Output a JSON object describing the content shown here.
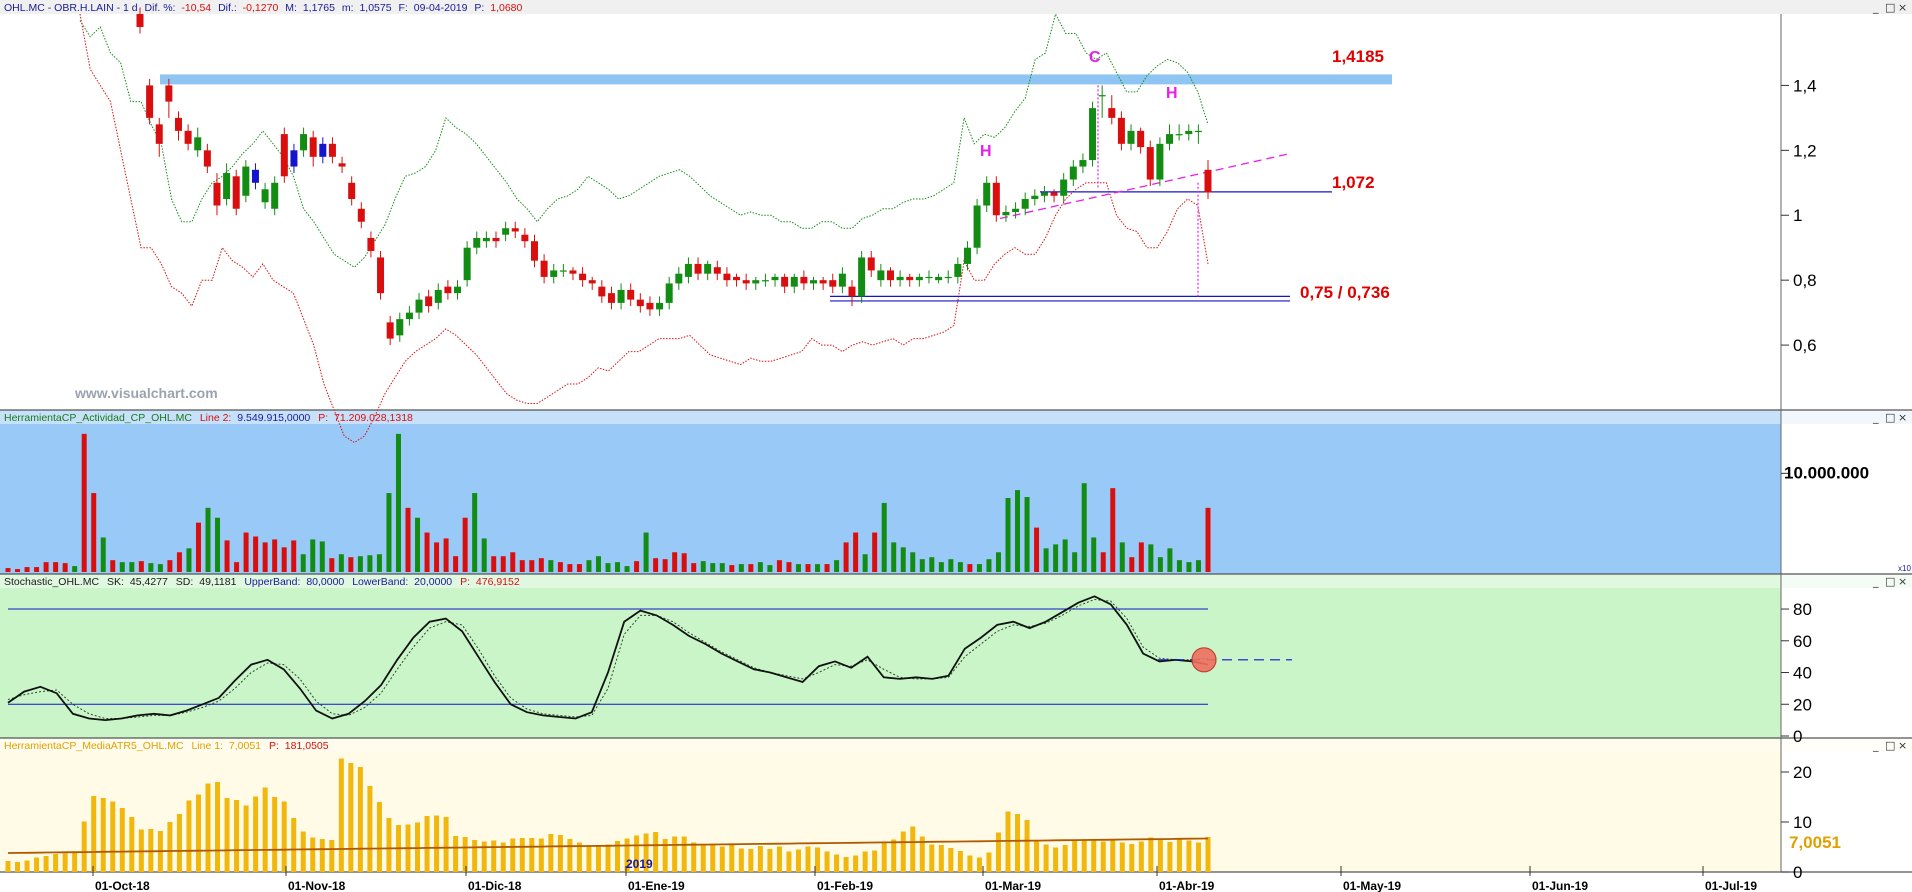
{
  "header": {
    "symbol": "OHL.MC - OBR.H.LAIN - 1 d",
    "dif_pct_label": "Dif. %:",
    "dif_pct_value": "-10,54",
    "dif_label": "Dif.:",
    "dif_value": "-0,1270",
    "max_label": "M:",
    "max_value": "1,1765",
    "min_label": "m:",
    "min_value": "1,0575",
    "date_label": "F:",
    "date_value": "09-04-2019",
    "price_label": "P:",
    "price_value": "1,0680"
  },
  "watermark": "www.visualchart.com",
  "window_buttons": [
    "_",
    "□",
    "×"
  ],
  "colors": {
    "up": "#138c13",
    "down": "#d90f0f",
    "inside": "#1515cc",
    "resistance_band": "#8ec5f2",
    "volume_bg": "#99c9f7",
    "stoch_bg": "#c9f5c9",
    "atr_bg": "#fffbe6",
    "atr_bar": "#f2b70d",
    "annotation_red": "#e00000",
    "annotation_magenta": "#e81ee8"
  },
  "panels": {
    "volume": {
      "title": "HerramientaCP_Actividad_CP_OHL.MC",
      "line_label": "Line 2:",
      "line_value": "9.549.915,0000",
      "p_label": "P:",
      "p_value": "71.209.028,1318",
      "scale_note": "x10"
    },
    "stochastic": {
      "title": "Stochastic_OHL.MC",
      "sk_label": "SK:",
      "sk_value": "45,4277",
      "sd_label": "SD:",
      "sd_value": "49,1181",
      "upper_label": "UpperBand:",
      "upper_value": "80,0000",
      "lower_label": "LowerBand:",
      "lower_value": "20,0000",
      "p_label": "P:",
      "p_value": "476,9152"
    },
    "atr": {
      "title": "HerramientaCP_MediaATR5_OHL.MC",
      "line_label": "Line 1:",
      "line_value": "7,0051",
      "p_label": "P:",
      "p_value": "181,0505",
      "last_value_label": "7,0051"
    }
  },
  "annotations": {
    "resistance": "1,4185",
    "neckline": "1,072",
    "target": "0,75 / 0,736",
    "pattern_h_left": "H",
    "pattern_c": "C",
    "pattern_h_right": "H",
    "year_marker": "2019"
  },
  "chart_data": [
    {
      "type": "candlestick",
      "name": "OHL.MC price",
      "yticks": [
        "1,4",
        "1,2",
        "1",
        "0,8",
        "0,6"
      ],
      "ylim": [
        0.4,
        1.62
      ],
      "x_ticks": [
        "01-Oct-18",
        "01-Nov-18",
        "01-Dic-18",
        "01-Ene-19",
        "01-Feb-19",
        "01-Mar-19",
        "01-Abr-19",
        "01-May-19",
        "01-Jun-19",
        "01-Jul-19"
      ],
      "close": [
        1.58,
        1.3,
        1.22,
        1.35,
        1.26,
        1.22,
        1.24,
        1.15,
        1.03,
        1.13,
        1.02,
        1.15,
        1.1,
        1.08,
        1.1,
        1.12,
        1.15,
        1.25,
        1.18,
        1.22,
        1.18,
        1.15,
        1.05,
        0.98,
        0.89,
        0.76,
        0.62,
        0.68,
        0.7,
        0.74,
        0.72,
        0.77,
        0.76,
        0.78,
        0.9,
        0.93,
        0.93,
        0.92,
        0.96,
        0.95,
        0.92,
        0.86,
        0.81,
        0.83,
        0.83,
        0.82,
        0.8,
        0.79,
        0.75,
        0.73,
        0.77,
        0.74,
        0.72,
        0.71,
        0.73,
        0.79,
        0.82,
        0.85,
        0.82,
        0.85,
        0.82,
        0.8,
        0.8,
        0.79,
        0.8,
        0.8,
        0.81,
        0.78,
        0.81,
        0.79,
        0.8,
        0.79,
        0.78,
        0.82,
        0.75,
        0.87,
        0.83,
        0.83,
        0.8,
        0.81,
        0.8,
        0.81,
        0.81,
        0.81,
        0.81,
        0.85,
        0.9,
        1.03,
        1.1,
        1.0,
        1.01,
        1.02,
        1.05,
        1.06,
        1.07,
        1.06,
        1.11,
        1.15,
        1.17,
        1.33,
        1.37,
        1.3,
        1.22,
        1.26,
        1.21,
        1.11,
        1.22,
        1.25,
        1.25,
        1.26,
        1.26,
        1.07
      ],
      "open": [
        1.62,
        1.4,
        1.28,
        1.4,
        1.3,
        1.26,
        1.2,
        1.2,
        1.1,
        1.05,
        1.12,
        1.06,
        1.14,
        1.04,
        1.02,
        1.25,
        1.2,
        1.2,
        1.24,
        1.18,
        1.22,
        1.16,
        1.1,
        1.02,
        0.93,
        0.87,
        0.67,
        0.63,
        0.68,
        0.7,
        0.75,
        0.73,
        0.78,
        0.76,
        0.8,
        0.9,
        0.92,
        0.93,
        0.94,
        0.96,
        0.94,
        0.92,
        0.86,
        0.81,
        0.83,
        0.83,
        0.82,
        0.8,
        0.78,
        0.76,
        0.73,
        0.77,
        0.74,
        0.73,
        0.71,
        0.73,
        0.79,
        0.81,
        0.85,
        0.82,
        0.84,
        0.82,
        0.81,
        0.8,
        0.79,
        0.8,
        0.8,
        0.81,
        0.78,
        0.81,
        0.79,
        0.8,
        0.8,
        0.78,
        0.78,
        0.75,
        0.87,
        0.8,
        0.83,
        0.8,
        0.81,
        0.8,
        0.81,
        0.8,
        0.81,
        0.81,
        0.85,
        0.9,
        1.03,
        1.1,
        1.0,
        1.01,
        1.02,
        1.05,
        1.06,
        1.07,
        1.06,
        1.11,
        1.15,
        1.17,
        1.37,
        1.33,
        1.3,
        1.22,
        1.26,
        1.21,
        1.11,
        1.22,
        1.25,
        1.25,
        1.26,
        1.14
      ],
      "high": [
        1.64,
        1.42,
        1.3,
        1.42,
        1.32,
        1.28,
        1.27,
        1.22,
        1.13,
        1.16,
        1.14,
        1.17,
        1.16,
        1.1,
        1.12,
        1.27,
        1.22,
        1.27,
        1.26,
        1.24,
        1.24,
        1.18,
        1.12,
        1.04,
        0.95,
        0.89,
        0.69,
        0.7,
        0.72,
        0.76,
        0.77,
        0.79,
        0.8,
        0.8,
        0.92,
        0.95,
        0.95,
        0.95,
        0.98,
        0.98,
        0.96,
        0.94,
        0.88,
        0.85,
        0.85,
        0.84,
        0.84,
        0.81,
        0.8,
        0.78,
        0.79,
        0.79,
        0.76,
        0.75,
        0.75,
        0.81,
        0.84,
        0.87,
        0.87,
        0.86,
        0.86,
        0.84,
        0.82,
        0.82,
        0.81,
        0.82,
        0.82,
        0.82,
        0.82,
        0.83,
        0.81,
        0.81,
        0.82,
        0.84,
        0.8,
        0.89,
        0.89,
        0.85,
        0.84,
        0.83,
        0.82,
        0.82,
        0.83,
        0.82,
        0.83,
        0.87,
        0.92,
        1.05,
        1.12,
        1.12,
        1.03,
        1.04,
        1.07,
        1.08,
        1.09,
        1.08,
        1.13,
        1.17,
        1.19,
        1.35,
        1.4,
        1.37,
        1.32,
        1.28,
        1.27,
        1.23,
        1.24,
        1.28,
        1.28,
        1.28,
        1.28,
        1.17
      ],
      "low": [
        1.56,
        1.28,
        1.18,
        1.3,
        1.23,
        1.2,
        1.18,
        1.13,
        1.0,
        1.03,
        1.0,
        1.04,
        1.08,
        1.02,
        1.0,
        1.1,
        1.13,
        1.18,
        1.15,
        1.16,
        1.16,
        1.13,
        1.03,
        0.96,
        0.87,
        0.74,
        0.6,
        0.61,
        0.66,
        0.68,
        0.7,
        0.71,
        0.74,
        0.74,
        0.78,
        0.88,
        0.9,
        0.9,
        0.92,
        0.93,
        0.9,
        0.84,
        0.79,
        0.79,
        0.81,
        0.8,
        0.78,
        0.77,
        0.73,
        0.71,
        0.71,
        0.72,
        0.7,
        0.69,
        0.69,
        0.71,
        0.77,
        0.79,
        0.8,
        0.8,
        0.8,
        0.78,
        0.78,
        0.77,
        0.77,
        0.78,
        0.78,
        0.76,
        0.76,
        0.77,
        0.77,
        0.77,
        0.76,
        0.76,
        0.72,
        0.73,
        0.81,
        0.78,
        0.78,
        0.78,
        0.78,
        0.78,
        0.79,
        0.79,
        0.79,
        0.79,
        0.83,
        0.88,
        1.01,
        0.98,
        0.98,
        0.99,
        1.0,
        1.03,
        1.04,
        1.04,
        1.04,
        1.09,
        1.13,
        1.15,
        1.3,
        1.28,
        1.2,
        1.2,
        1.19,
        1.09,
        1.09,
        1.2,
        1.23,
        1.23,
        1.22,
        1.05
      ],
      "upper_band": [
        1.6,
        1.55,
        1.58,
        1.5,
        1.47,
        1.35,
        1.35,
        1.28,
        1.22,
        1.05,
        0.98,
        0.98,
        1.05,
        1.1,
        1.12,
        1.15,
        1.19,
        1.22,
        1.26,
        1.22,
        1.18,
        1.12,
        1.02,
        0.98,
        0.93,
        0.88,
        0.86,
        0.84,
        0.87,
        0.92,
        0.97,
        1.05,
        1.12,
        1.13,
        1.15,
        1.2,
        1.3,
        1.27,
        1.25,
        1.22,
        1.18,
        1.14,
        1.1,
        1.05,
        1.02,
        0.98,
        1.02,
        1.05,
        1.06,
        1.08,
        1.12,
        1.1,
        1.08,
        1.05,
        1.06,
        1.08,
        1.1,
        1.12,
        1.13,
        1.14,
        1.12,
        1.09,
        1.06,
        1.04,
        1.02,
        1.0,
        1.01,
        1.0,
        1.0,
        0.98,
        0.98,
        0.96,
        0.96,
        0.98,
        0.98,
        0.96,
        0.96,
        0.99,
        1.0,
        1.02,
        1.02,
        1.04,
        1.05,
        1.05,
        1.06,
        1.08,
        1.1,
        1.3,
        1.22,
        1.25,
        1.24,
        1.27,
        1.32,
        1.36,
        1.48,
        1.5,
        1.62,
        1.56,
        1.56,
        1.5,
        1.48,
        1.5,
        1.44,
        1.38,
        1.38,
        1.43,
        1.46,
        1.48,
        1.47,
        1.44,
        1.38,
        1.28
      ],
      "lower_band": [
        1.62,
        1.45,
        1.4,
        1.35,
        1.2,
        1.05,
        0.9,
        0.9,
        0.85,
        0.78,
        0.76,
        0.72,
        0.8,
        0.8,
        0.9,
        0.86,
        0.84,
        0.81,
        0.85,
        0.8,
        0.78,
        0.76,
        0.68,
        0.6,
        0.48,
        0.4,
        0.32,
        0.3,
        0.32,
        0.38,
        0.45,
        0.5,
        0.55,
        0.58,
        0.6,
        0.62,
        0.65,
        0.63,
        0.6,
        0.57,
        0.53,
        0.49,
        0.45,
        0.43,
        0.42,
        0.42,
        0.44,
        0.46,
        0.48,
        0.48,
        0.5,
        0.53,
        0.52,
        0.55,
        0.58,
        0.58,
        0.6,
        0.62,
        0.62,
        0.62,
        0.63,
        0.6,
        0.57,
        0.56,
        0.55,
        0.54,
        0.56,
        0.55,
        0.55,
        0.56,
        0.57,
        0.58,
        0.62,
        0.6,
        0.6,
        0.58,
        0.6,
        0.61,
        0.6,
        0.61,
        0.62,
        0.6,
        0.62,
        0.62,
        0.63,
        0.64,
        0.66,
        0.86,
        0.8,
        0.8,
        0.85,
        0.88,
        0.9,
        0.88,
        0.88,
        0.93,
        1.0,
        1.05,
        1.08,
        1.1,
        1.1,
        1.1,
        1.0,
        0.96,
        0.95,
        0.9,
        0.9,
        0.95,
        1.02,
        1.05,
        1.03,
        0.85
      ]
    },
    {
      "type": "bar",
      "name": "Actividad volume",
      "yticks": [
        "10.000.000"
      ],
      "values": [
        0.4,
        0.3,
        0.5,
        0.5,
        1.0,
        1.0,
        0.9,
        0.6,
        14.0,
        8.0,
        3.5,
        1.2,
        1.0,
        1.0,
        1.1,
        0.9,
        0.8,
        1.2,
        2.0,
        2.4,
        5.0,
        6.5,
        5.5,
        3.2,
        1.0,
        4.0,
        3.6,
        3.0,
        3.3,
        2.5,
        3.2,
        1.8,
        3.3,
        3.1,
        1.4,
        1.8,
        1.5,
        1.6,
        1.7,
        1.8,
        8.0,
        14.0,
        6.5,
        5.5,
        4.0,
        3.0,
        3.4,
        1.6,
        5.5,
        8.0,
        3.4,
        1.6,
        1.6,
        2.0,
        1.2,
        1.2,
        1.4,
        1.2,
        1.0,
        0.8,
        0.8,
        1.2,
        1.6,
        0.9,
        1.0,
        0.6,
        1.1,
        4.0,
        1.4,
        1.3,
        2.0,
        1.9,
        0.9,
        1.1,
        0.9,
        0.9,
        0.7,
        0.8,
        0.8,
        1.0,
        0.7,
        1.2,
        1.0,
        0.8,
        0.8,
        0.8,
        0.8,
        1.2,
        3.0,
        4.0,
        1.8,
        4.0,
        7.0,
        3.0,
        2.5,
        2.0,
        1.3,
        1.5,
        1.0,
        1.3,
        1.0,
        0.8,
        0.8,
        1.3,
        2.0,
        7.5,
        8.3,
        7.6,
        4.5,
        2.4,
        2.8,
        3.3,
        2.0,
        9.0,
        3.5,
        2.0,
        8.5,
        3.0,
        1.5,
        3.0,
        2.8,
        1.5,
        2.4,
        1.2,
        1.0,
        1.2,
        6.5
      ]
    },
    {
      "type": "line",
      "name": "Stochastic",
      "yticks": [
        "80",
        "60",
        "40",
        "20",
        "0"
      ],
      "ylim": [
        0,
        92
      ],
      "upper_band": 80,
      "lower_band": 20,
      "sk": [
        21,
        28,
        31,
        27,
        14,
        11,
        10,
        11,
        13,
        14,
        13,
        16,
        20,
        24,
        35,
        45,
        48,
        42,
        30,
        16,
        11,
        14,
        22,
        32,
        48,
        62,
        72,
        74,
        66,
        50,
        34,
        20,
        15,
        13,
        12,
        11,
        15,
        40,
        72,
        79,
        76,
        70,
        63,
        58,
        52,
        47,
        42,
        40,
        37,
        34,
        44,
        47,
        43,
        50,
        37,
        36,
        37,
        36,
        38,
        55,
        62,
        70,
        72,
        68,
        72,
        78,
        84,
        88,
        83,
        70,
        52,
        47,
        48,
        47,
        45
      ],
      "sd": [
        23,
        26,
        28,
        29,
        20,
        14,
        11,
        11,
        12,
        13,
        13,
        15,
        18,
        22,
        30,
        40,
        46,
        45,
        36,
        22,
        14,
        13,
        18,
        27,
        42,
        56,
        68,
        72,
        70,
        55,
        38,
        24,
        17,
        14,
        13,
        12,
        13,
        30,
        64,
        76,
        76,
        72,
        65,
        59,
        53,
        48,
        43,
        40,
        38,
        36,
        40,
        45,
        44,
        48,
        42,
        37,
        36,
        36,
        37,
        50,
        58,
        66,
        70,
        69,
        71,
        76,
        82,
        86,
        85,
        74,
        56,
        49,
        48,
        48,
        49
      ],
      "extension_level": 48
    },
    {
      "type": "bar",
      "name": "MediaATR5",
      "yticks": [
        "20",
        "10",
        "0"
      ],
      "ylim": [
        0,
        24
      ],
      "values": [
        2.2,
        2.0,
        2.3,
        2.9,
        3.2,
        3.6,
        3.7,
        4.1,
        10.1,
        15.2,
        14.8,
        14.1,
        12.8,
        11.0,
        8.5,
        8.6,
        8.2,
        10.0,
        11.6,
        14.3,
        15.5,
        17.7,
        18.0,
        14.8,
        14.4,
        13.3,
        15.1,
        16.9,
        15.0,
        14.1,
        10.8,
        8.1,
        6.9,
        6.6,
        6.4,
        22.7,
        21.8,
        21.0,
        17.2,
        14.0,
        10.8,
        9.4,
        9.5,
        9.9,
        11.2,
        11.3,
        11.0,
        7.2,
        7.0,
        6.4,
        6.1,
        6.3,
        5.9,
        6.7,
        6.8,
        6.8,
        6.7,
        7.6,
        7.4,
        6.6,
        5.9,
        5.3,
        5.1,
        5.5,
        6.2,
        6.7,
        7.3,
        7.7,
        8.0,
        6.6,
        7.1,
        7.1,
        5.9,
        5.6,
        5.4,
        5.1,
        5.5,
        4.7,
        4.6,
        5.2,
        4.6,
        5.1,
        4.1,
        4.5,
        5.1,
        4.9,
        4.1,
        3.5,
        3.0,
        3.3,
        4.1,
        4.3,
        5.9,
        6.5,
        8.1,
        9.1,
        7.1,
        5.5,
        5.4,
        4.8,
        4.2,
        3.3,
        2.9,
        3.9,
        7.9,
        12.1,
        11.6,
        10.4,
        6.4,
        5.5,
        4.9,
        5.4,
        6.3,
        6.4,
        6.6,
        6.1,
        6.5,
        5.9,
        5.6,
        6.1,
        6.9,
        6.7,
        6.0,
        6.5,
        6.3,
        5.9,
        7.0
      ]
    }
  ]
}
